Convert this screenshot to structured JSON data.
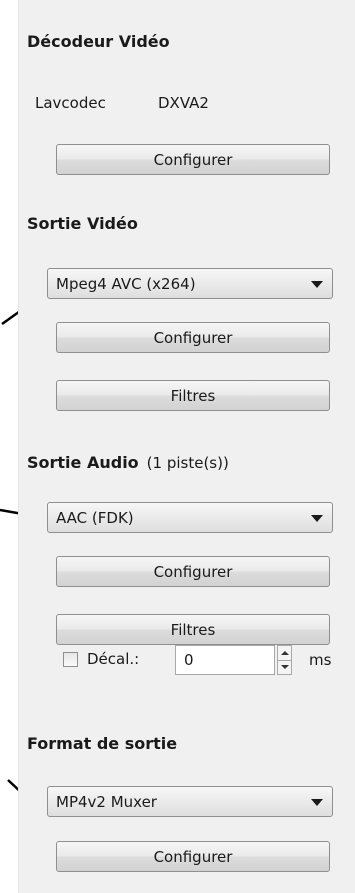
{
  "video_decoder": {
    "title": "Décodeur Vidéo",
    "decoder_name": "Lavcodec",
    "decoder_mode": "DXVA2",
    "configure_label": "Configurer"
  },
  "video_output": {
    "title": "Sortie Vidéo",
    "codec_selected": "Mpeg4 AVC (x264)",
    "configure_label": "Configurer",
    "filters_label": "Filtres"
  },
  "audio_output": {
    "title": "Sortie Audio",
    "track_count": "(1 piste(s))",
    "codec_selected": "AAC (FDK)",
    "configure_label": "Configurer",
    "filters_label": "Filtres",
    "shift_label": "Décal.:",
    "shift_value": "0",
    "shift_unit": "ms"
  },
  "output_format": {
    "title": "Format de sortie",
    "muxer_selected": "MP4v2 Muxer",
    "configure_label": "Configurer"
  },
  "icons": [
    "chevron-down-icon",
    "spinner-up-icon",
    "spinner-down-icon",
    "pointer-arrow-icon"
  ]
}
